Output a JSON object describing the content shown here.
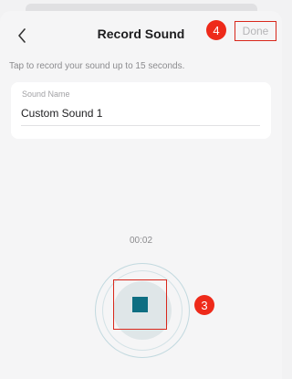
{
  "header": {
    "title": "Record Sound",
    "done_label": "Done",
    "back_icon": "chevron-left-icon"
  },
  "annotations": {
    "step_done": "4",
    "step_stop": "3",
    "color": "#ee2a1a"
  },
  "hint": "Tap to record your sound up to 15 seconds.",
  "sound_name": {
    "label": "Sound Name",
    "value": "Custom Sound 1"
  },
  "recorder": {
    "elapsed": "00:02",
    "stop_icon": "stop-icon",
    "accent": "#0e6e82"
  }
}
